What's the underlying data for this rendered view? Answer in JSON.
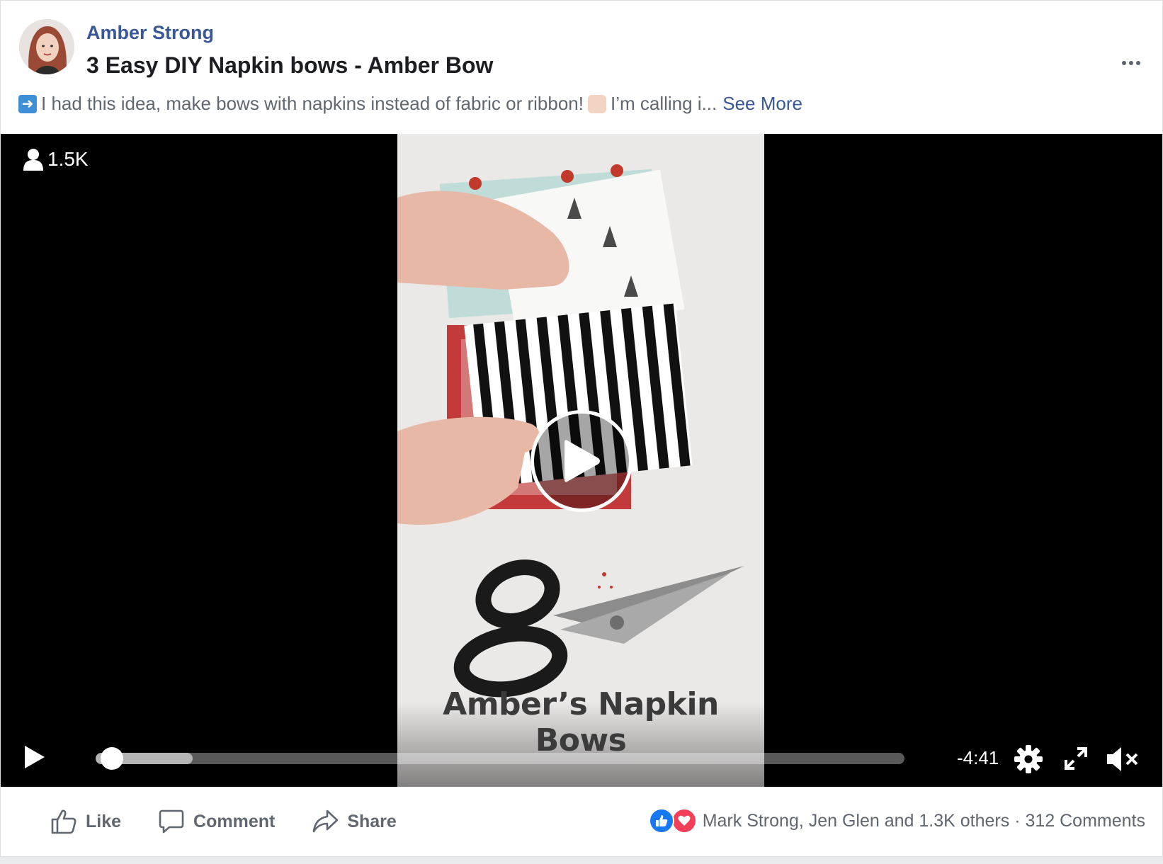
{
  "post": {
    "author": "Amber Strong",
    "title": "3 Easy DIY Napkin bows - Amber Bow",
    "description_before_emoji": "I had this idea, make bows with napkins instead of fabric or ribbon!",
    "description_after_emoji": "I’m calling i...",
    "see_more": "See More"
  },
  "video": {
    "viewers": "1.5K",
    "caption": "Amber’s Napkin Bows",
    "time_remaining": "-4:41",
    "progress_fraction": 0.01,
    "buffered_fraction": 0.12
  },
  "actions": {
    "like": "Like",
    "comment": "Comment",
    "share": "Share"
  },
  "reactions": {
    "summary": "Mark Strong, Jen Glen and 1.3K others · 312 Comments"
  },
  "icons": [
    "arrow-right-emoji",
    "raising-hands-emoji",
    "person-icon",
    "play-icon",
    "gear-icon",
    "expand-icon",
    "mute-icon",
    "thumbs-up-icon",
    "comment-icon",
    "share-icon",
    "like-reaction-icon",
    "love-reaction-icon",
    "more-icon"
  ],
  "colors": {
    "link": "#385898",
    "like": "#1877f2",
    "love": "#f33e58"
  }
}
